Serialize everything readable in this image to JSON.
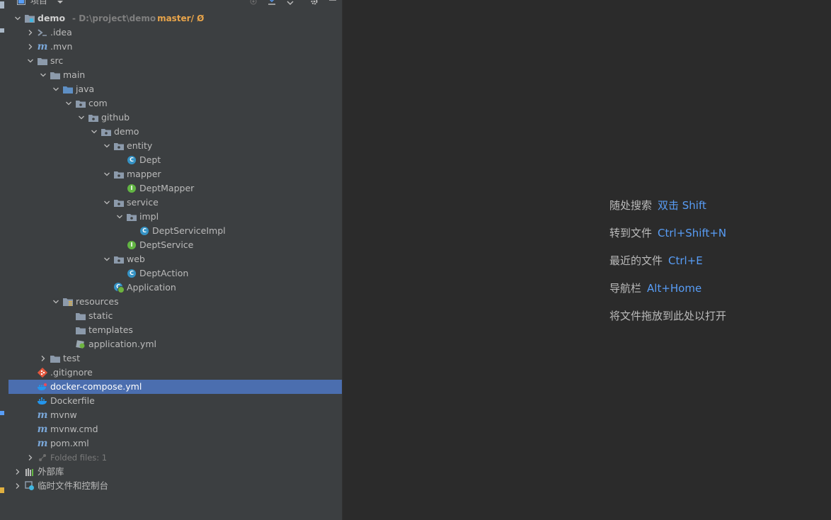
{
  "panel": {
    "title": "项目"
  },
  "tree": [
    {
      "level": 0,
      "arrow": "down",
      "icon": "module",
      "label": "demo",
      "bold": true,
      "sub": "D:\\project\\demo",
      "branch": "master/ Ø"
    },
    {
      "level": 1,
      "arrow": "right",
      "icon": "idea",
      "label": ".idea"
    },
    {
      "level": 1,
      "arrow": "right",
      "icon": "maven",
      "label": ".mvn"
    },
    {
      "level": 1,
      "arrow": "down",
      "icon": "folder",
      "label": "src"
    },
    {
      "level": 2,
      "arrow": "down",
      "icon": "folder",
      "label": "main"
    },
    {
      "level": 3,
      "arrow": "down",
      "icon": "folder-blue",
      "label": "java"
    },
    {
      "level": 4,
      "arrow": "down",
      "icon": "package",
      "label": "com"
    },
    {
      "level": 5,
      "arrow": "down",
      "icon": "package",
      "label": "github"
    },
    {
      "level": 6,
      "arrow": "down",
      "icon": "package",
      "label": "demo"
    },
    {
      "level": 7,
      "arrow": "down",
      "icon": "package",
      "label": "entity"
    },
    {
      "level": 8,
      "arrow": "none",
      "icon": "class",
      "label": "Dept"
    },
    {
      "level": 7,
      "arrow": "down",
      "icon": "package",
      "label": "mapper"
    },
    {
      "level": 8,
      "arrow": "none",
      "icon": "interface",
      "label": "DeptMapper"
    },
    {
      "level": 7,
      "arrow": "down",
      "icon": "package",
      "label": "service"
    },
    {
      "level": 8,
      "arrow": "down",
      "icon": "package",
      "label": "impl"
    },
    {
      "level": 9,
      "arrow": "none",
      "icon": "class",
      "label": "DeptServiceImpl"
    },
    {
      "level": 8,
      "arrow": "none",
      "icon": "interface",
      "label": "DeptService"
    },
    {
      "level": 7,
      "arrow": "down",
      "icon": "package",
      "label": "web"
    },
    {
      "level": 8,
      "arrow": "none",
      "icon": "class",
      "label": "DeptAction"
    },
    {
      "level": 7,
      "arrow": "none",
      "icon": "spring-class",
      "label": "Application"
    },
    {
      "level": 3,
      "arrow": "down",
      "icon": "resources",
      "label": "resources"
    },
    {
      "level": 4,
      "arrow": "none",
      "icon": "folder",
      "label": "static"
    },
    {
      "level": 4,
      "arrow": "none",
      "icon": "folder",
      "label": "templates"
    },
    {
      "level": 4,
      "arrow": "none",
      "icon": "yml",
      "label": "application.yml"
    },
    {
      "level": 2,
      "arrow": "right",
      "icon": "folder",
      "label": "test"
    },
    {
      "level": 1,
      "arrow": "none",
      "icon": "gitignore",
      "label": ".gitignore"
    },
    {
      "level": 1,
      "arrow": "none",
      "icon": "docker-compose",
      "label": "docker-compose.yml",
      "selected": true
    },
    {
      "level": 1,
      "arrow": "none",
      "icon": "docker",
      "label": "Dockerfile"
    },
    {
      "level": 1,
      "arrow": "none",
      "icon": "maven",
      "label": "mvnw"
    },
    {
      "level": 1,
      "arrow": "none",
      "icon": "maven",
      "label": "mvnw.cmd"
    },
    {
      "level": 1,
      "arrow": "none",
      "icon": "maven",
      "label": "pom.xml"
    },
    {
      "level": 1,
      "arrow": "right",
      "icon": "folded",
      "label": "Folded files: 1",
      "muted": true
    },
    {
      "level": 0,
      "arrow": "right",
      "icon": "library",
      "label": "外部库"
    },
    {
      "level": 0,
      "arrow": "right",
      "icon": "scratches",
      "label": "临时文件和控制台"
    }
  ],
  "editor": {
    "hints": [
      {
        "label": "随处搜索",
        "key": "双击 Shift"
      },
      {
        "label": "转到文件",
        "key": "Ctrl+Shift+N"
      },
      {
        "label": "最近的文件",
        "key": "Ctrl+E"
      },
      {
        "label": "导航栏",
        "key": "Alt+Home"
      },
      {
        "label": "将文件拖放到此处以打开",
        "key": ""
      }
    ]
  },
  "colors": {
    "selection": "#4b6eaf",
    "folder": "#8c9aab",
    "folder_blue": "#5e8fc4",
    "class": "#3592c4",
    "interface": "#62b543",
    "key": "#589df6",
    "branch": "#e8a44a"
  }
}
